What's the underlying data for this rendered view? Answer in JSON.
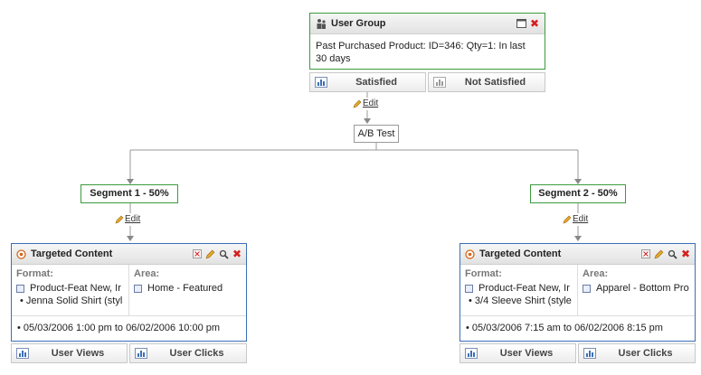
{
  "user_group": {
    "title": "User Group",
    "condition": "Past Purchased Product: ID=346: Qty=1: In last 30 days",
    "satisfied_label": "Satisfied",
    "not_satisfied_label": "Not Satisfied"
  },
  "edit_label": "Edit",
  "ab_test_label": "A/B Test",
  "segments": [
    {
      "label": "Segment 1 - 50%",
      "content": {
        "title": "Targeted Content",
        "format_label": "Format:",
        "format_value": "Product-Feat New, Ir",
        "item": "Jenna Solid Shirt (styl",
        "area_label": "Area:",
        "area_value": "Home - Featured",
        "date_range": "05/03/2006 1:00 pm to 06/02/2006 10:00 pm",
        "user_views_label": "User Views",
        "user_clicks_label": "User Clicks"
      }
    },
    {
      "label": "Segment 2 - 50%",
      "content": {
        "title": "Targeted Content",
        "format_label": "Format:",
        "format_value": "Product-Feat New, Ir",
        "item": "3/4 Sleeve Shirt (style",
        "area_label": "Area:",
        "area_value": "Apparel - Bottom Pro",
        "date_range": "05/03/2006 7:15 am to 06/02/2006 8:15 pm",
        "user_views_label": "User Views",
        "user_clicks_label": "User Clicks"
      }
    }
  ],
  "icons": {
    "user_group": "user-group-icon",
    "maximize": "maximize-icon",
    "close": "close-icon",
    "chart": "bar-chart-icon",
    "pencil": "pencil-icon",
    "target": "target-icon",
    "search": "magnifier-icon",
    "format_item": "product-icon",
    "area_item": "layout-icon"
  },
  "colors": {
    "green_border": "#3c9a3c",
    "blue_border": "#3b6fb6",
    "close_red": "#d42020"
  }
}
